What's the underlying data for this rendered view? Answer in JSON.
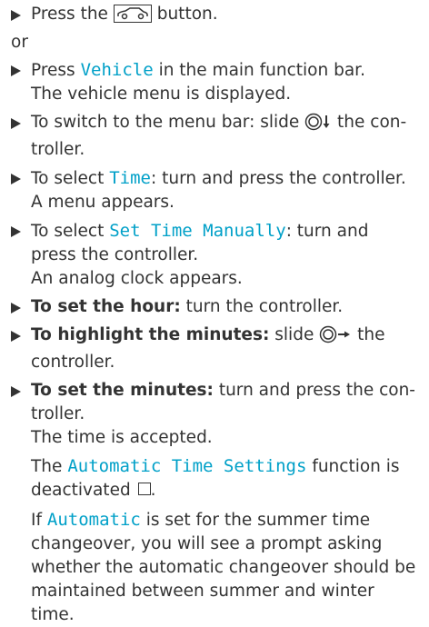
{
  "steps": [
    {
      "pre": "Press the",
      "post": "button."
    },
    {
      "or": "or"
    },
    {
      "text_a": "Press",
      "vehicle": "Vehicle",
      "text_b": "in the main function bar.",
      "result": "The vehicle menu is displayed."
    },
    {
      "text_a": "To switch to the menu bar: slide",
      "text_b": "the con-",
      "text_c": "troller."
    },
    {
      "text_a": "To select",
      "time": "Time",
      "text_b": ": turn and press the controller.",
      "result": "A menu appears."
    },
    {
      "text_a": "To select",
      "stm": "Set Time Manually",
      "text_b": ": turn and",
      "text_c": "press the controller.",
      "result": "An analog clock appears."
    },
    {
      "bold": "To set the hour:",
      "text": "turn the controller."
    },
    {
      "bold": "To highlight the minutes:",
      "text_a": "slide",
      "text_b": "the",
      "text_c": "controller."
    },
    {
      "bold": "To set the minutes:",
      "text_a": "turn and press the con-",
      "text_b": "troller.",
      "result": "The time is accepted."
    }
  ],
  "para1": {
    "text_a": "The",
    "ats": "Automatic Time Settings",
    "text_b": "function is",
    "text_c": "deactivated"
  },
  "para2": {
    "text_a": "If",
    "auto": "Automatic",
    "text_b": "is set for the summer time",
    "line2": "changeover, you will see a prompt asking",
    "line3": "whether the automatic changeover should be",
    "line4": "maintained between summer and winter",
    "line5": "time."
  },
  "icons": [
    "vehicle-button-icon",
    "controller-slide-down-icon",
    "controller-slide-right-icon",
    "checkbox-empty-icon"
  ]
}
